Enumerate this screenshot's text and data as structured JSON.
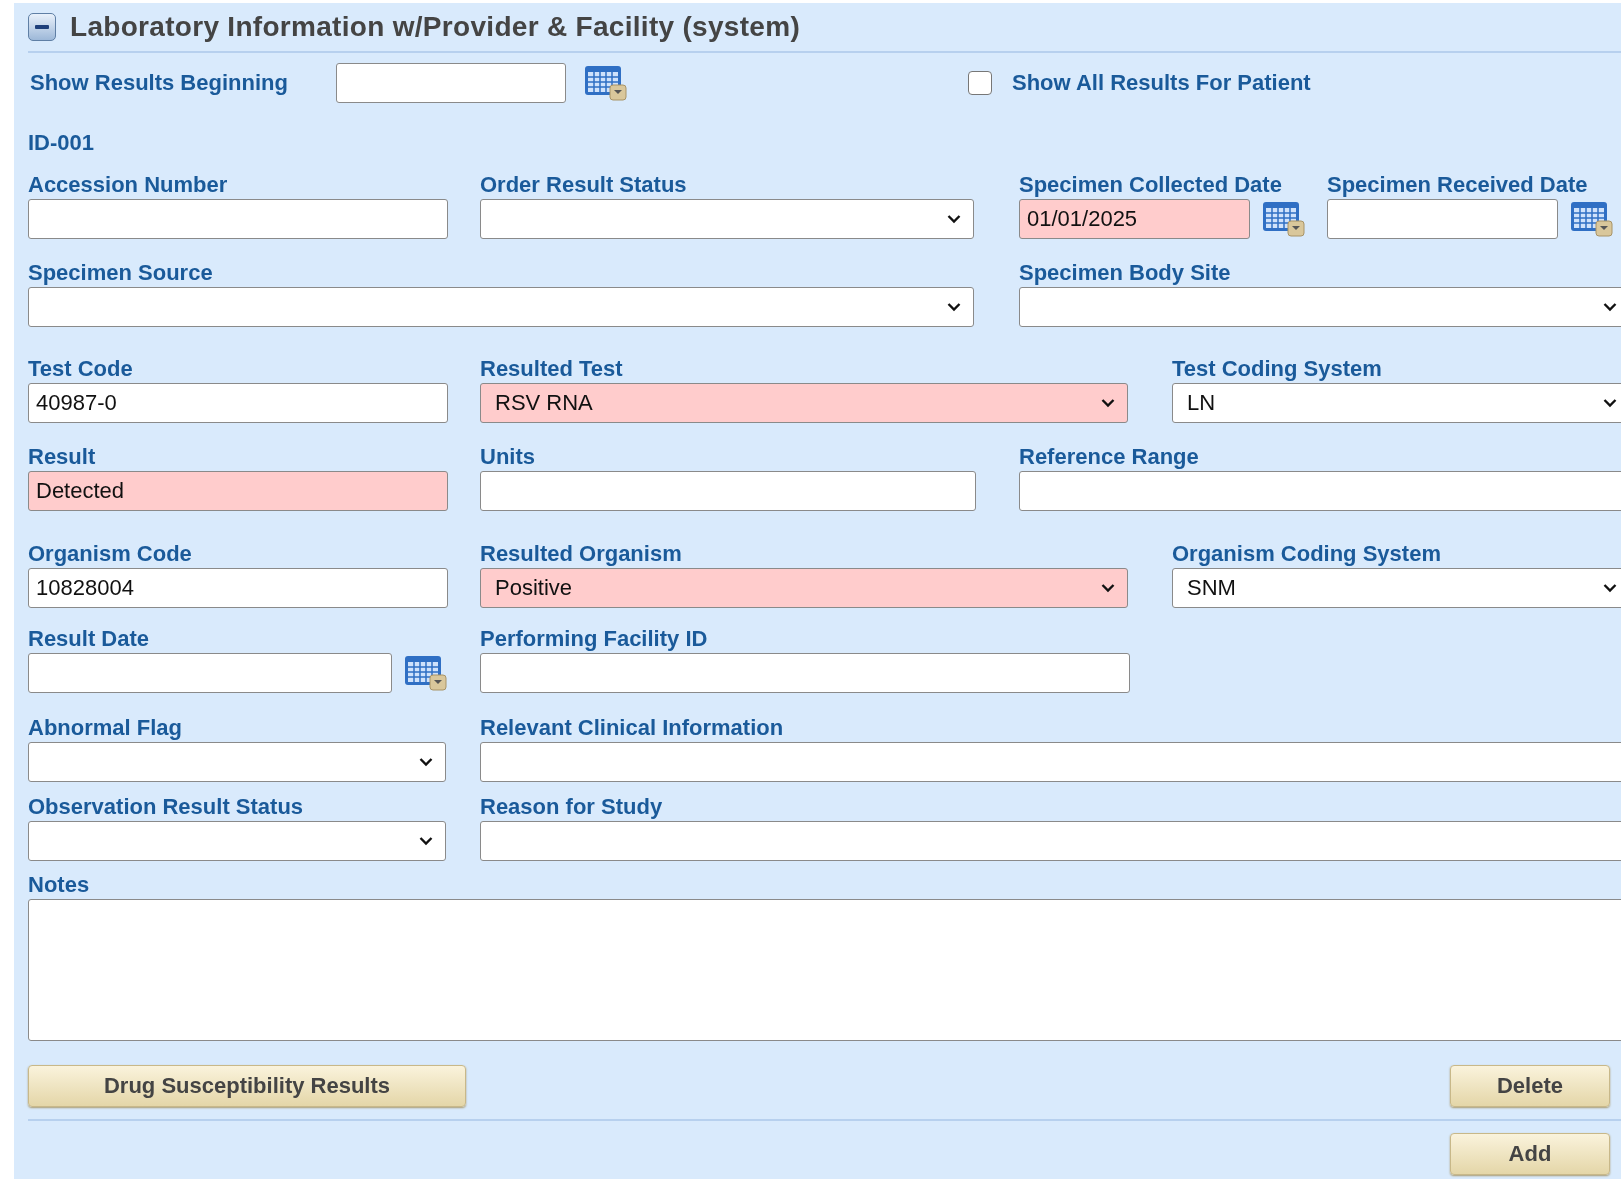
{
  "section": {
    "title": "Laboratory Information w/Provider & Facility (system)",
    "expanded": true
  },
  "filter": {
    "label": "Show Results Beginning",
    "show_all": {
      "label": "Show All Results For Patient",
      "checked": false
    }
  },
  "record_id": "ID-001",
  "rows": [
    [
      {
        "label": "Accession Number",
        "kind": "text",
        "highlighted": false
      },
      {
        "label": "Order Result Status",
        "kind": "select",
        "highlighted": false
      },
      {
        "label": "Specimen Collected Date",
        "kind": "date",
        "value": "01/01/2025",
        "highlighted": true
      },
      {
        "label": "Specimen Received Date",
        "kind": "date",
        "highlighted": false
      }
    ],
    [
      {
        "label": "Specimen Source",
        "kind": "select",
        "highlighted": false
      },
      {
        "label": "Specimen Body Site",
        "kind": "select",
        "highlighted": false
      }
    ],
    [
      {
        "label": "Test Code",
        "kind": "text",
        "value": "40987-0",
        "highlighted": false
      },
      {
        "label": "Resulted Test",
        "kind": "select",
        "value": "RSV RNA",
        "highlighted": true
      },
      {
        "label": "Test Coding System",
        "kind": "select",
        "value": "LN",
        "highlighted": false
      }
    ],
    [
      {
        "label": "Result",
        "kind": "text",
        "value": "Detected",
        "highlighted": true
      },
      {
        "label": "Units",
        "kind": "text",
        "highlighted": false
      },
      {
        "label": "Reference Range",
        "kind": "text",
        "highlighted": false
      }
    ],
    [
      {
        "label": "Organism Code",
        "kind": "text",
        "value": "10828004",
        "highlighted": false
      },
      {
        "label": "Resulted Organism",
        "kind": "select",
        "value": "Positive",
        "highlighted": true
      },
      {
        "label": "Organism Coding System",
        "kind": "select",
        "value": "SNM",
        "highlighted": false
      }
    ],
    [
      {
        "label": "Result Date",
        "kind": "date",
        "highlighted": false
      },
      {
        "label": "Performing Facility ID",
        "kind": "text",
        "highlighted": false
      }
    ],
    [
      {
        "label": "Abnormal Flag",
        "kind": "select",
        "highlighted": false
      },
      {
        "label": "Relevant Clinical Information",
        "kind": "text",
        "highlighted": false
      }
    ],
    [
      {
        "label": "Observation Result Status",
        "kind": "select",
        "highlighted": false
      },
      {
        "label": "Reason for Study",
        "kind": "text",
        "highlighted": false
      }
    ],
    [
      {
        "label": "Notes",
        "kind": "textarea",
        "highlighted": false
      }
    ]
  ],
  "buttons": {
    "left": "Drug Susceptibility Results",
    "delete": "Delete",
    "add": "Add"
  }
}
